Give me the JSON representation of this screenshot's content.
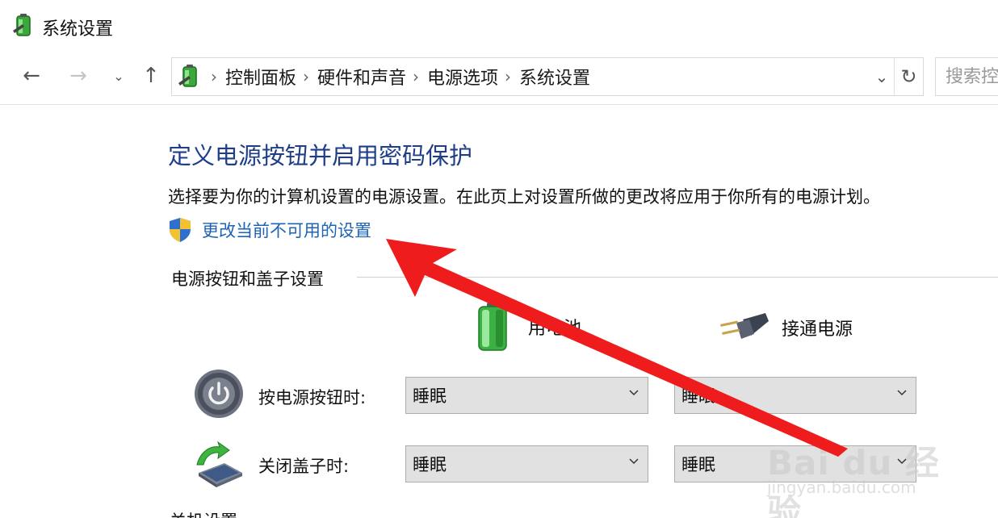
{
  "window": {
    "title": "系统设置"
  },
  "nav": {
    "back_icon": "back-arrow-icon",
    "forward_icon": "forward-arrow-icon",
    "recent_icon": "chevron-down-icon",
    "up_icon": "up-arrow-icon",
    "breadcrumbs": [
      "控制面板",
      "硬件和声音",
      "电源选项",
      "系统设置"
    ],
    "search_placeholder": "搜索控"
  },
  "page": {
    "heading": "定义电源按钮并启用密码保护",
    "description": "选择要为你的计算机设置的电源设置。在此页上对设置所做的更改将应用于你所有的电源计划。",
    "change_link": "更改当前不可用的设置"
  },
  "power_section": {
    "title": "电源按钮和盖子设置",
    "columns": [
      "用电池",
      "接通电源"
    ],
    "rows": [
      {
        "label": "按电源按钮时:",
        "battery": "睡眠",
        "plugged": "睡眠"
      },
      {
        "label": "关闭盖子时:",
        "battery": "睡眠",
        "plugged": "睡眠"
      }
    ],
    "next_section_partial": "关机设置"
  },
  "watermark": {
    "brand": "Bai du 经验",
    "url": "jingyan.baidu.com"
  },
  "colors": {
    "heading": "#1e3e8a",
    "link": "#1e64b4",
    "annotation_arrow": "#ee1c1c"
  }
}
